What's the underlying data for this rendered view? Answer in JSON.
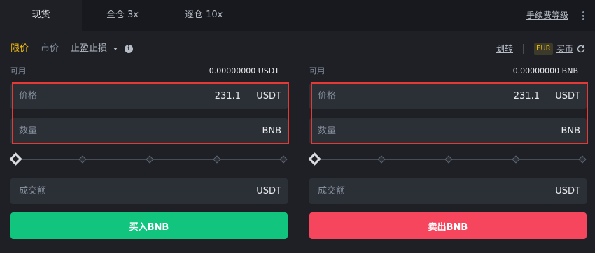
{
  "tabs": {
    "spot": "现货",
    "cross": "全仓 3x",
    "isolated": "逐仓 10x",
    "fee_link": "手续费等级"
  },
  "order_types": {
    "limit": "限价",
    "market": "市价",
    "stop_limit": "止盈止损"
  },
  "header_links": {
    "transfer": "划转",
    "currency_badge": "EUR",
    "buy_coin": "买币"
  },
  "buy_panel": {
    "available_label": "可用",
    "available_value": "0.00000000 USDT",
    "price_label": "价格",
    "price_value": "231.1",
    "price_unit": "USDT",
    "amount_label": "数量",
    "amount_value": "",
    "amount_unit": "BNB",
    "slider_percent": 0,
    "total_label": "成交额",
    "total_value": "",
    "total_unit": "USDT",
    "button_label": "买入BNB"
  },
  "sell_panel": {
    "available_label": "可用",
    "available_value": "0.00000000 BNB",
    "price_label": "价格",
    "price_value": "231.1",
    "price_unit": "USDT",
    "amount_label": "数量",
    "amount_value": "",
    "amount_unit": "BNB",
    "slider_percent": 0,
    "total_label": "成交额",
    "total_value": "",
    "total_unit": "USDT",
    "button_label": "卖出BNB"
  },
  "colors": {
    "accent": "#f0b90b",
    "buy": "#12c57f",
    "sell": "#f6465d",
    "highlight": "#e53935"
  },
  "icons": [
    "more-vertical-icon",
    "caret-down-icon",
    "info-icon",
    "refresh-icon",
    "slider-handle-icon"
  ]
}
